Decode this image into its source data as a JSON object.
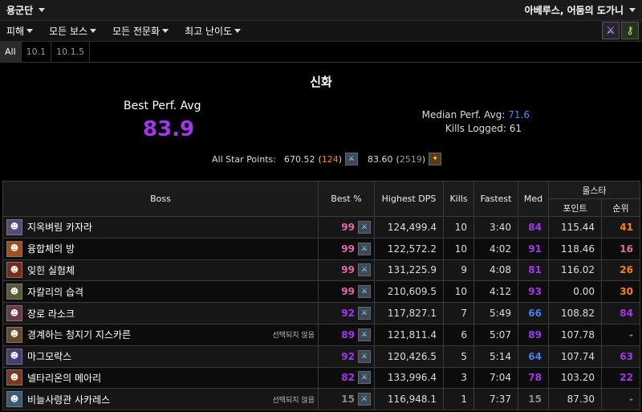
{
  "topbar": {
    "guild": "용군단",
    "character": "아베루스, 어둠의 도가니"
  },
  "menu": [
    "피해",
    "모든 보스",
    "모든 전문화",
    "최고 난이도"
  ],
  "menu_icons": {
    "raid": "raid-icon",
    "key": "key-icon"
  },
  "tabs": [
    {
      "label": "All",
      "active": true
    },
    {
      "label": "10.1",
      "active": false
    },
    {
      "label": "10.1.5",
      "active": false
    }
  ],
  "summary": {
    "difficulty": "신화",
    "best_perf_label": "Best Perf. Avg",
    "best_perf_value": "83.9",
    "median_label": "Median Perf. Avg:",
    "median_value": "71.6",
    "kills_label": "Kills Logged:",
    "kills_value": "61",
    "star_label": "All Star Points:",
    "star_points_1": "670.52",
    "star_rank_1": "124",
    "star_points_2": "83.60",
    "star_rank_2": "2519"
  },
  "table": {
    "headers": {
      "boss": "Boss",
      "best": "Best %",
      "dps": "Highest DPS",
      "kills": "Kills",
      "fastest": "Fastest",
      "med": "Med",
      "allstar": "올스타",
      "points": "포인트",
      "rank": "순위"
    },
    "rows": [
      {
        "boss": "지옥벼림 카자라",
        "note": "",
        "best": "99",
        "dps": "124,499.4",
        "kills": "10",
        "fastest": "3:40",
        "med": "84",
        "points": "115.44",
        "rank": "41",
        "icon_color": "#5a4a7a",
        "best_color": "pink",
        "med_color": "epic",
        "rank_color": "legend"
      },
      {
        "boss": "융합체의 방",
        "note": "",
        "best": "99",
        "dps": "122,572.2",
        "kills": "10",
        "fastest": "4:02",
        "med": "91",
        "points": "118.46",
        "rank": "16",
        "icon_color": "#a0501a",
        "best_color": "pink",
        "med_color": "epic",
        "rank_color": "pink"
      },
      {
        "boss": "잊힌 실험체",
        "note": "",
        "best": "99",
        "dps": "131,225.9",
        "kills": "9",
        "fastest": "4:08",
        "med": "81",
        "points": "116.02",
        "rank": "26",
        "icon_color": "#7a2a1a",
        "best_color": "pink",
        "med_color": "epic",
        "rank_color": "legend"
      },
      {
        "boss": "자칼리의 습격",
        "note": "",
        "best": "99",
        "dps": "210,609.5",
        "kills": "10",
        "fastest": "4:12",
        "med": "93",
        "points": "0.00",
        "rank": "30",
        "icon_color": "#5a5a3a",
        "best_color": "pink",
        "med_color": "epic",
        "rank_color": "legend"
      },
      {
        "boss": "장로 라소크",
        "note": "",
        "best": "92",
        "dps": "117,827.1",
        "kills": "7",
        "fastest": "5:49",
        "med": "66",
        "points": "108.82",
        "rank": "84",
        "icon_color": "#6a3a4a",
        "best_color": "epic",
        "med_color": "blue",
        "rank_color": "epic"
      },
      {
        "boss": "경계하는 청지기 지스카른",
        "note": "선택되지 않음",
        "best": "89",
        "dps": "121,811.4",
        "kills": "6",
        "fastest": "5:07",
        "med": "89",
        "points": "107.78",
        "rank": "-",
        "icon_color": "#6a4a2a",
        "best_color": "epic",
        "med_color": "epic",
        "rank_color": "gray"
      },
      {
        "boss": "마그모락스",
        "note": "",
        "best": "92",
        "dps": "120,426.5",
        "kills": "5",
        "fastest": "5:14",
        "med": "64",
        "points": "107.74",
        "rank": "63",
        "icon_color": "#4a3a7a",
        "best_color": "epic",
        "med_color": "blue",
        "rank_color": "epic"
      },
      {
        "boss": "넬타리온의 메아리",
        "note": "",
        "best": "82",
        "dps": "133,996.4",
        "kills": "3",
        "fastest": "7:04",
        "med": "78",
        "points": "103.20",
        "rank": "22",
        "icon_color": "#7a3a1a",
        "best_color": "epic",
        "med_color": "epic",
        "rank_color": "epic"
      },
      {
        "boss": "비늘사령관 사카레스",
        "note": "선택되지 않음",
        "best": "15",
        "dps": "116,948.1",
        "kills": "1",
        "fastest": "7:37",
        "med": "15",
        "points": "87.30",
        "rank": "-",
        "icon_color": "#3a5a7a",
        "best_color": "gray",
        "med_color": "gray",
        "rank_color": "gray"
      }
    ]
  }
}
